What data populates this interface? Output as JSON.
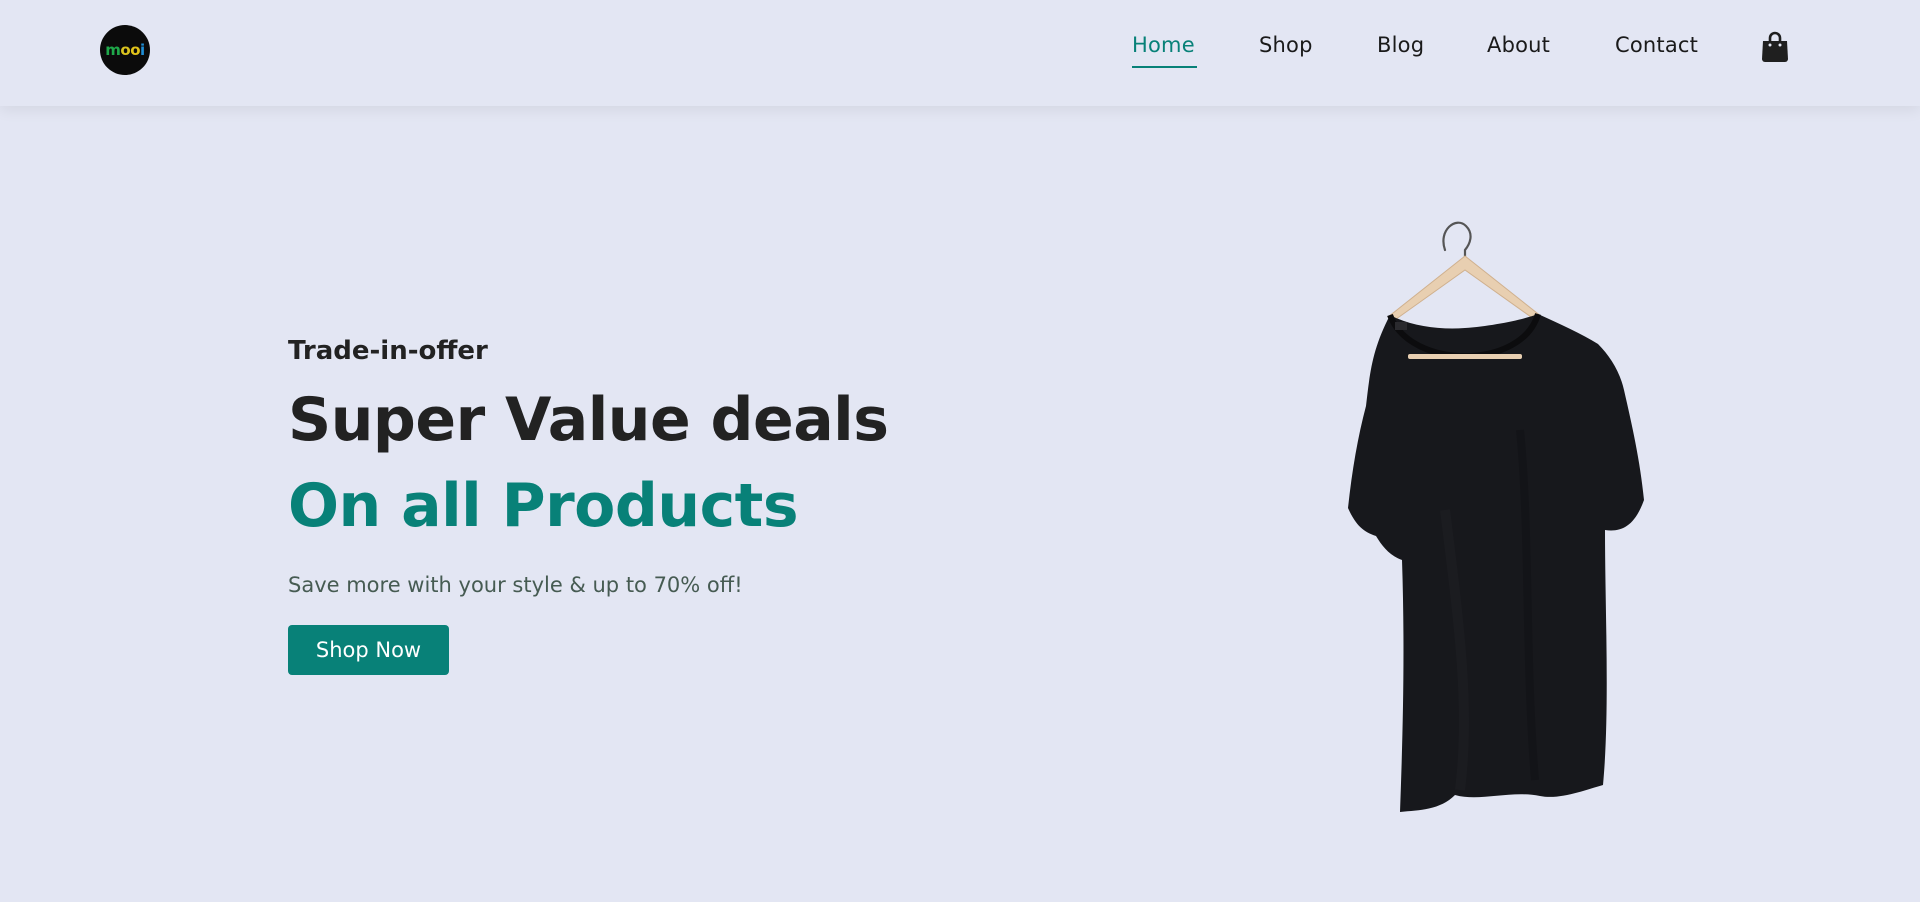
{
  "header": {
    "logo_icon": "mooi-logo",
    "logo_text": {
      "m": "m",
      "o1": "o",
      "o2": "o",
      "i": "i"
    },
    "nav": [
      {
        "label": "Home",
        "active": true
      },
      {
        "label": "Shop",
        "active": false
      },
      {
        "label": "Blog",
        "active": false
      },
      {
        "label": "About",
        "active": false
      },
      {
        "label": "Contact",
        "active": false
      }
    ],
    "cart_icon": "shopping-bag-icon"
  },
  "hero": {
    "kicker": "Trade-in-offer",
    "headline": "Super Value deals",
    "headline_accent": "On all Products",
    "subtitle": "Save more with your style & up to 70% off!",
    "cta_label": "Shop Now",
    "image": "black-tshirt-on-hanger"
  },
  "colors": {
    "background": "#e3e6f3",
    "accent": "#088178",
    "text_dark": "#222222"
  }
}
